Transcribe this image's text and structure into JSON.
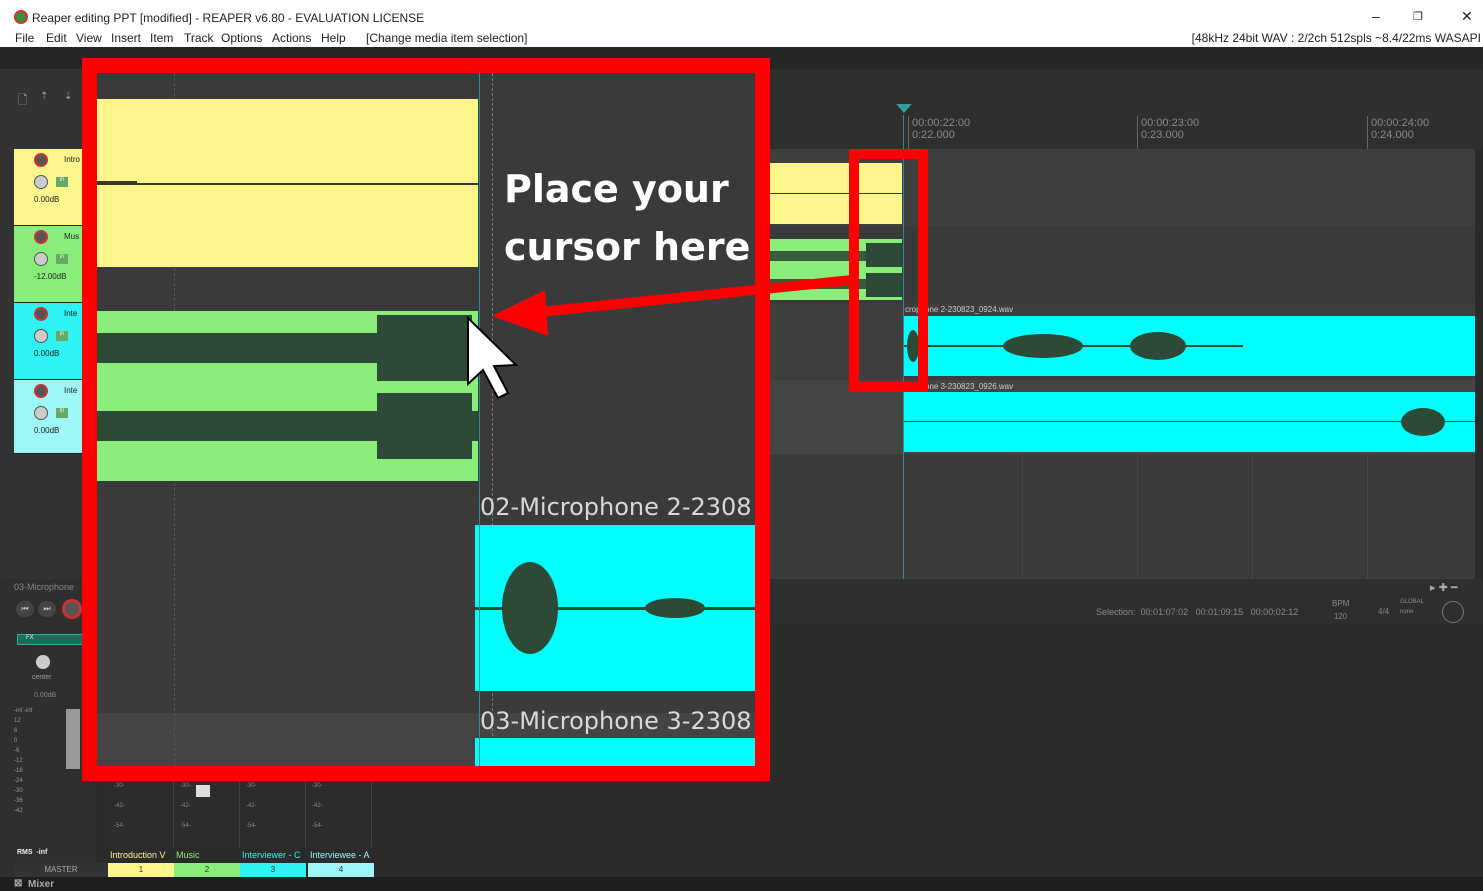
{
  "window": {
    "title": "Reaper editing PPT [modified] - REAPER v6.80 - EVALUATION LICENSE",
    "minimize": "–",
    "restore": "❐",
    "close": "✕"
  },
  "menu": {
    "items": [
      "File",
      "Edit",
      "View",
      "Insert",
      "Item",
      "Track",
      "Options",
      "Actions",
      "Help",
      "[Change media item selection]"
    ],
    "status": "[48kHz 24bit WAV : 2/2ch 512spls ~8.4/22ms WASAPI"
  },
  "ruler": {
    "labels": [
      {
        "time": "00:00:22:00",
        "sub": "0:22.000"
      },
      {
        "time": "00:00:23:00",
        "sub": "0:23.000"
      },
      {
        "time": "00:00:24:00",
        "sub": "0:24.000"
      }
    ]
  },
  "tracks": [
    {
      "num": "1",
      "name": "Intro",
      "vol": "0.00dB",
      "color": "#fbf58c"
    },
    {
      "num": "2",
      "name": "Mus",
      "vol": "-12.00dB",
      "color": "#8aed7a"
    },
    {
      "num": "3",
      "name": "Inte",
      "vol": "0.00dB",
      "color": "#2ff2f2"
    },
    {
      "num": "4",
      "name": "Inte",
      "vol": "0.00dB",
      "color": "#2ff2f2"
    }
  ],
  "items": {
    "mic2": "02-Microphone 2-230823_0924.wav",
    "mic2_visible": "crophone 2-230823_0924.wav",
    "mic3_visible": "crophone 3-230823_0926.wav"
  },
  "transport": {
    "selection_label": "Selection:",
    "sel_start": "00:01:07:02",
    "sel_end": "00:01:09:15",
    "sel_len": "00:00:02:12",
    "bpm_label": "BPM",
    "bpm": "120",
    "sig": "4/4",
    "global": "GLOBAL",
    "none": "none"
  },
  "mcp": {
    "name": "03-Microphone",
    "fx": "FX",
    "pan": "center",
    "db": "0.00dB",
    "scale": [
      "-inf  -inf",
      "12",
      "6",
      "0",
      "-6",
      "-12",
      "-18",
      "-24",
      "-30",
      "-36",
      "-42"
    ]
  },
  "mixer": {
    "rms_label": "RMS",
    "rms_value": "-inf",
    "master": "MASTER",
    "strips": [
      {
        "name": "Introduction V",
        "idx": "1",
        "color": "#fbf58c"
      },
      {
        "name": "Music",
        "idx": "2",
        "color": "#8aed7a"
      },
      {
        "name": "Interviewer - C",
        "idx": "3",
        "color": "#2ff2f2"
      },
      {
        "name": "Interviewee - A",
        "idx": "4",
        "color": "#9ef6f6"
      }
    ],
    "tab": "Mixer"
  },
  "zoom": {
    "callout_line1": "Place your",
    "callout_line2": "cursor here",
    "label_mic2": "02-Microphone 2-2308",
    "label_mic3": "03-Microphone 3-2308"
  },
  "colors": {
    "highlight": "#ff0000",
    "yellow": "#fbf58c",
    "green": "#8aed7a",
    "cyan": "#00ffff",
    "wave": "#2d4a36"
  }
}
